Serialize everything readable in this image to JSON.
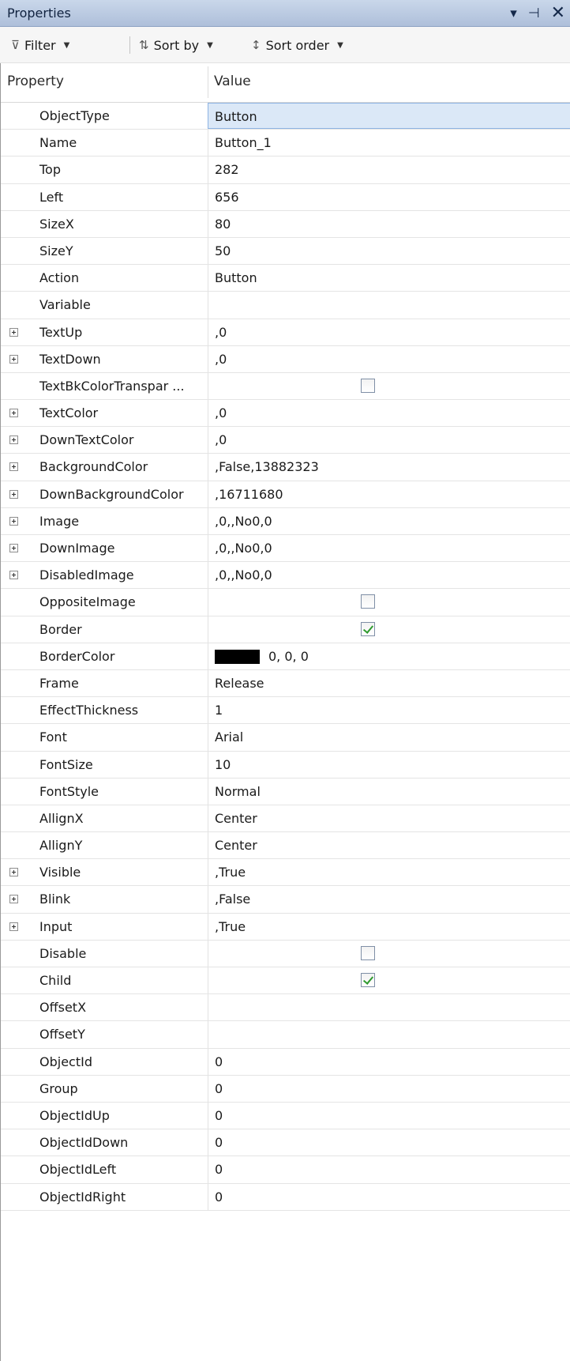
{
  "window": {
    "title": "Properties"
  },
  "toolbar": {
    "filter_label": "Filter",
    "sortby_label": "Sort by",
    "sortorder_label": "Sort order"
  },
  "grid": {
    "col_property": "Property",
    "col_value": "Value",
    "selected_row": 0,
    "rows": [
      {
        "name": "ObjectType",
        "value": "Button"
      },
      {
        "name": "Name",
        "value": "Button_1"
      },
      {
        "name": "Top",
        "value": "282"
      },
      {
        "name": "Left",
        "value": "656"
      },
      {
        "name": "SizeX",
        "value": "80"
      },
      {
        "name": "SizeY",
        "value": "50"
      },
      {
        "name": "Action",
        "value": "Button"
      },
      {
        "name": "Variable",
        "value": ""
      },
      {
        "name": "TextUp",
        "value": ",0",
        "expandable": true
      },
      {
        "name": "TextDown",
        "value": ",0",
        "expandable": true
      },
      {
        "name": "TextBkColorTranspar ...",
        "checkbox": false
      },
      {
        "name": "TextColor",
        "value": ",0",
        "expandable": true
      },
      {
        "name": "DownTextColor",
        "value": ",0",
        "expandable": true
      },
      {
        "name": "BackgroundColor",
        "value": ",False,13882323",
        "expandable": true
      },
      {
        "name": "DownBackgroundColor",
        "value": ",16711680",
        "expandable": true
      },
      {
        "name": "Image",
        "value": ",0,,No0,0",
        "expandable": true
      },
      {
        "name": "DownImage",
        "value": ",0,,No0,0",
        "expandable": true
      },
      {
        "name": "DisabledImage",
        "value": ",0,,No0,0",
        "expandable": true
      },
      {
        "name": "OppositeImage",
        "checkbox": false
      },
      {
        "name": "Border",
        "checkbox": true
      },
      {
        "name": "BorderColor",
        "color": "#000000",
        "value": "0, 0, 0"
      },
      {
        "name": "Frame",
        "value": "Release"
      },
      {
        "name": "EffectThickness",
        "value": "1"
      },
      {
        "name": "Font",
        "value": "Arial"
      },
      {
        "name": "FontSize",
        "value": "10"
      },
      {
        "name": "FontStyle",
        "value": "Normal"
      },
      {
        "name": "AllignX",
        "value": "Center"
      },
      {
        "name": "AllignY",
        "value": "Center"
      },
      {
        "name": "Visible",
        "value": ",True",
        "expandable": true
      },
      {
        "name": "Blink",
        "value": ",False",
        "expandable": true
      },
      {
        "name": "Input",
        "value": ",True",
        "expandable": true
      },
      {
        "name": "Disable",
        "checkbox": false
      },
      {
        "name": "Child",
        "checkbox": true
      },
      {
        "name": "OffsetX",
        "value": ""
      },
      {
        "name": "OffsetY",
        "value": ""
      },
      {
        "name": "ObjectId",
        "value": "0"
      },
      {
        "name": "Group",
        "value": "0"
      },
      {
        "name": "ObjectIdUp",
        "value": "0"
      },
      {
        "name": "ObjectIdDown",
        "value": "0"
      },
      {
        "name": "ObjectIdLeft",
        "value": "0"
      },
      {
        "name": "ObjectIdRight",
        "value": "0"
      }
    ]
  }
}
